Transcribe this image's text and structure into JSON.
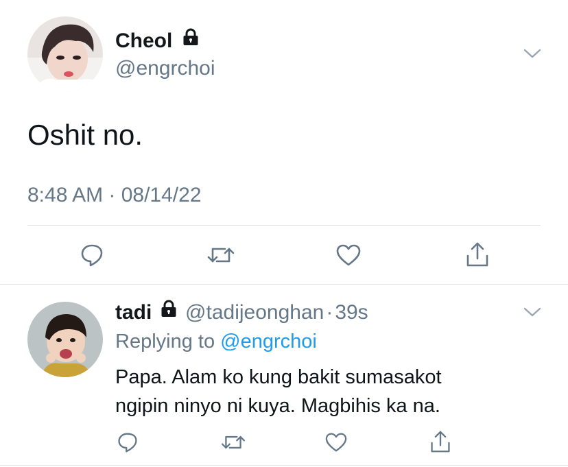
{
  "main_tweet": {
    "display_name": "Cheol",
    "handle": "@engrchoi",
    "text": "Oshit no.",
    "timestamp": "8:48 AM · 08/14/22"
  },
  "reply": {
    "display_name": "tadi",
    "handle": "@tadijeonghan",
    "separator": "·",
    "age": "39s",
    "replying_prefix": "Replying to",
    "replying_to": "@engrchoi",
    "text_line1": "Papa. Alam ko kung bakit sumasakot",
    "text_line2": "ngipin ninyo ni kuya. Magbihis ka na."
  },
  "icons": [
    "lock-icon",
    "chevron-down-icon",
    "reply-icon",
    "retweet-icon",
    "like-icon",
    "share-icon"
  ],
  "colors": {
    "text": "#14171a",
    "muted": "#657786",
    "link": "#1d9bf0",
    "divider": "#dfe3e7"
  }
}
